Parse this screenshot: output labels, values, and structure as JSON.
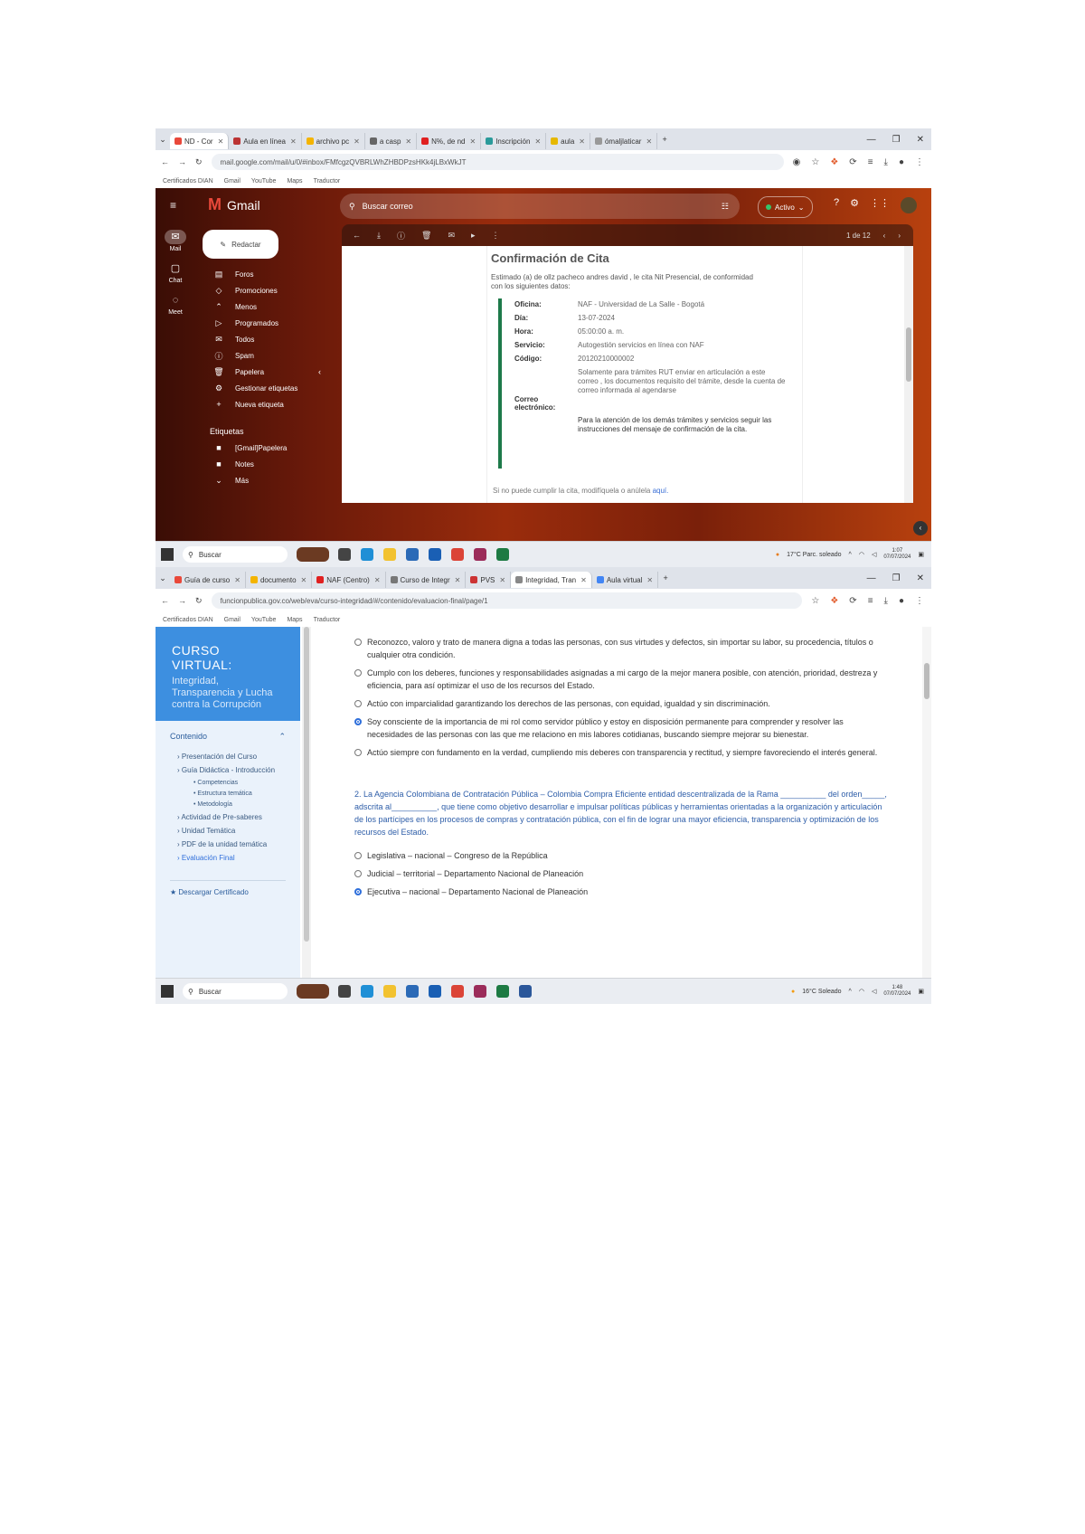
{
  "shot1": {
    "tabs": [
      "ND - Cor",
      "Aula en línea",
      "archivo pc",
      "a casp",
      "N%, de nd",
      "Inscripción",
      "aula",
      "ómaljlaticar"
    ],
    "url": "mail.google.com/mail/u/0/#inbox/FMfcgzQVBRLWhZHBDPzsHKk4jLBxWkJT",
    "bookmarks": [
      "Certificados DIAN",
      "Gmail",
      "YouTube",
      "Maps",
      "Traductor"
    ],
    "gmail": {
      "logo": "Gmail",
      "search_placeholder": "Buscar correo",
      "status": "Activo",
      "rail": [
        {
          "icon": "✉",
          "label": "Mail"
        },
        {
          "icon": "▢",
          "label": "Chat"
        },
        {
          "icon": "◌",
          "label": "Meet"
        }
      ],
      "compose": "Redactar",
      "nav": [
        {
          "icon": "▤",
          "label": "Foros"
        },
        {
          "icon": "◇",
          "label": "Promociones"
        },
        {
          "icon": "⌃",
          "label": "Menos"
        },
        {
          "icon": "▷",
          "label": "Programados"
        },
        {
          "icon": "✉",
          "label": "Todos"
        },
        {
          "icon": "ⓘ",
          "label": "Spam"
        },
        {
          "icon": "🗑",
          "label": "Papelera"
        },
        {
          "icon": "⚙",
          "label": "Gestionar etiquetas"
        },
        {
          "icon": "+",
          "label": "Nueva etiqueta"
        }
      ],
      "labels_title": "Etiquetas",
      "labels": [
        "[Gmail]Papelera",
        "Notes",
        "Más"
      ],
      "pager": "1 de 12",
      "email": {
        "title": "Confirmación de Cita",
        "intro": "Estimado (a) de ollz pacheco andres david , le cita Nit Presencial, de conformidad con los siguientes datos:",
        "rows": [
          {
            "k": "Oficina:",
            "v": "NAF - Universidad de La Salle - Bogotá"
          },
          {
            "k": "Día:",
            "v": "13-07-2024"
          },
          {
            "k": "Hora:",
            "v": "05:00:00 a. m."
          },
          {
            "k": "Servicio:",
            "v": "Autogestión servicios en línea con NAF"
          },
          {
            "k": "Código:",
            "v": "20120210000002"
          },
          {
            "k": "Correo electrónico:",
            "v": "Solamente para trámites RUT enviar en articulación a este correo , los documentos requisito del trámite, desde la cuenta de correo informada al agendarse"
          },
          {
            "k": "",
            "v": "Para la atención de los demás trámites y servicios seguir las instrucciones del mensaje de confirmación de la cita."
          }
        ],
        "footer_text": "Si no puede cumplir la cita, modifíquela o anúlela ",
        "footer_link": "aquí."
      }
    },
    "taskbar": {
      "search": "Buscar",
      "weather": "17°C Parc. soleado",
      "time": "1:07",
      "date": "07/07/2024"
    }
  },
  "shot2": {
    "tabs": [
      "Guía de curso",
      "documento",
      "NAF (Centro)",
      "Curso de Integr",
      "PVS",
      "Integridad, Tran",
      "Aula virtual"
    ],
    "url": "funcionpublica.gov.co/web/eva/curso-integridad/#/contenido/evaluacion-final/page/1",
    "bookmarks": [
      "Certificados DIAN",
      "Gmail",
      "YouTube",
      "Maps",
      "Traductor"
    ],
    "course": {
      "title": "CURSO VIRTUAL:",
      "subtitle": "Integridad, Transparencia y Lucha contra la Corrupción",
      "content_label": "Contenido",
      "items": [
        "Presentación del Curso",
        "Guía Didáctica - Introducción"
      ],
      "subitems": [
        "Competencias",
        "Estructura temática",
        "Metodología"
      ],
      "items2": [
        "Actividad de Pre-saberes",
        "Unidad Temática",
        "PDF de la unidad temática",
        "Evaluación Final"
      ],
      "certificate": "Descargar Certificado",
      "options1": [
        {
          "text": "Reconozco, valoro y trato de manera digna a todas las personas, con sus virtudes y defectos, sin importar su labor, su procedencia, títulos o cualquier otra condición.",
          "selected": false
        },
        {
          "text": "Cumplo con los deberes, funciones y responsabilidades asignadas a mi cargo de la mejor manera posible, con atención, prioridad, destreza y eficiencia, para así optimizar el uso de los recursos del Estado.",
          "selected": false
        },
        {
          "text": "Actúo con imparcialidad garantizando los derechos de las personas, con equidad, igualdad y sin discriminación.",
          "selected": false
        },
        {
          "text": "Soy consciente de la importancia de mi rol como servidor público y estoy en disposición permanente para comprender y resolver las necesidades de las personas con las que me relaciono en mis labores cotidianas, buscando siempre mejorar su bienestar.",
          "selected": true
        },
        {
          "text": "Actúo siempre con fundamento en la verdad, cumpliendo mis deberes con transparencia y rectitud, y siempre favoreciendo el interés general.",
          "selected": false
        }
      ],
      "question2": "2. La Agencia Colombiana de Contratación Pública – Colombia Compra Eficiente entidad descentralizada de la Rama __________ del orden_____, adscrita al__________, que tiene como objetivo desarrollar e impulsar políticas públicas y herramientas orientadas a la organización y articulación de los partícipes en los procesos de compras y contratación pública, con el fin de lograr una mayor eficiencia, transparencia y optimización de los recursos del Estado.",
      "options2": [
        {
          "text": "Legislativa – nacional – Congreso de la República",
          "selected": false
        },
        {
          "text": "Judicial – territorial – Departamento Nacional de Planeación",
          "selected": false
        },
        {
          "text": "Ejecutiva – nacional – Departamento Nacional de Planeación",
          "selected": true
        }
      ]
    },
    "taskbar": {
      "search": "Buscar",
      "weather": "16°C Soleado",
      "time": "1:48",
      "date": "07/07/2024"
    }
  }
}
